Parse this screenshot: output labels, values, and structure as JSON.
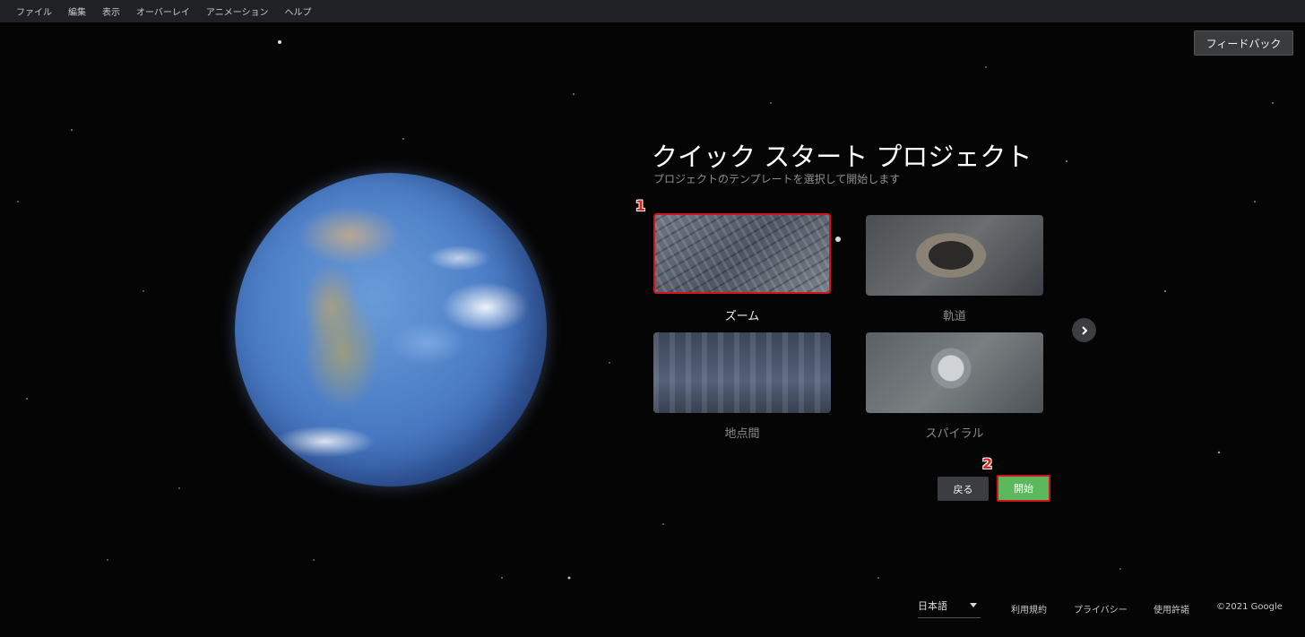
{
  "menubar": {
    "items": [
      "ファイル",
      "編集",
      "表示",
      "オーバーレイ",
      "アニメーション",
      "ヘルプ"
    ]
  },
  "feedback_label": "フィードバック",
  "quick_start": {
    "title": "クイック スタート プロジェクト",
    "subtitle": "プロジェクトのテンプレートを選択して開始します",
    "templates": [
      {
        "label": "ズーム",
        "selected": true
      },
      {
        "label": "軌道",
        "selected": false
      },
      {
        "label": "地点間",
        "selected": false
      },
      {
        "label": "スパイラル",
        "selected": false
      }
    ]
  },
  "annotations": [
    "1",
    "2"
  ],
  "buttons": {
    "back": "戻る",
    "start": "開始"
  },
  "footer": {
    "language": "日本語",
    "terms": "利用規約",
    "privacy": "プライバシー",
    "license": "使用許諾",
    "copyright": "©2021 Google"
  },
  "colors": {
    "highlight": "#d4141c",
    "start_button": "#5cb85c"
  }
}
